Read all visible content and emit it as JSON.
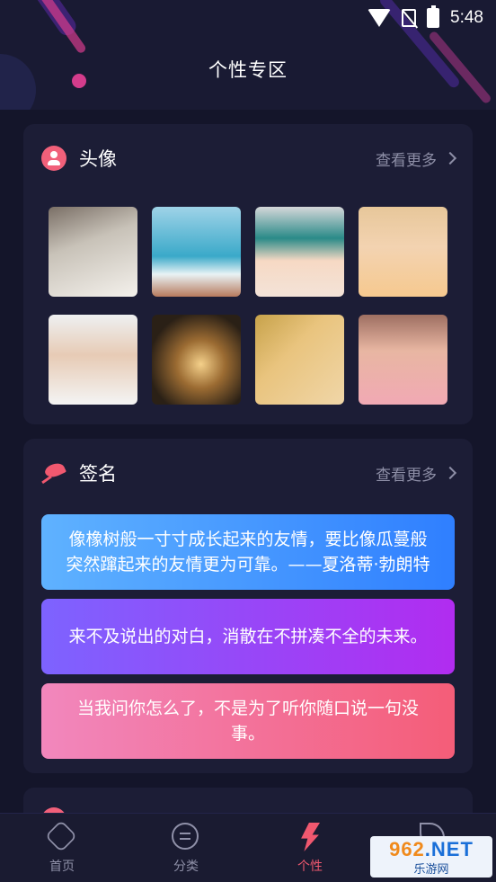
{
  "status_bar": {
    "time": "5:48"
  },
  "header": {
    "title": "个性专区"
  },
  "avatars_section": {
    "title": "头像",
    "more": "查看更多",
    "thumbnails": [
      "avatar-1",
      "avatar-2",
      "avatar-3",
      "avatar-4",
      "avatar-5",
      "avatar-6",
      "avatar-7",
      "avatar-8"
    ]
  },
  "signature_section": {
    "title": "签名",
    "more": "查看更多",
    "quotes": [
      "像橡树般一寸寸成长起来的友情，要比像瓜蔓般突然蹿起来的友情更为可靠。——夏洛蒂·勃朗特",
      "来不及说出的对白，消散在不拼凑不全的未来。",
      "当我问你怎么了，不是为了听你随口说一句没事。"
    ]
  },
  "tabbar": {
    "items": [
      {
        "label": "首页"
      },
      {
        "label": "分类"
      },
      {
        "label": "个性"
      },
      {
        "label": ""
      }
    ]
  },
  "watermark": {
    "top_a": "962",
    "top_b": ".NET",
    "bottom": "乐游网"
  },
  "colors": {
    "accent": "#f0586f",
    "background": "#14152a",
    "card": "#1c1d36"
  }
}
